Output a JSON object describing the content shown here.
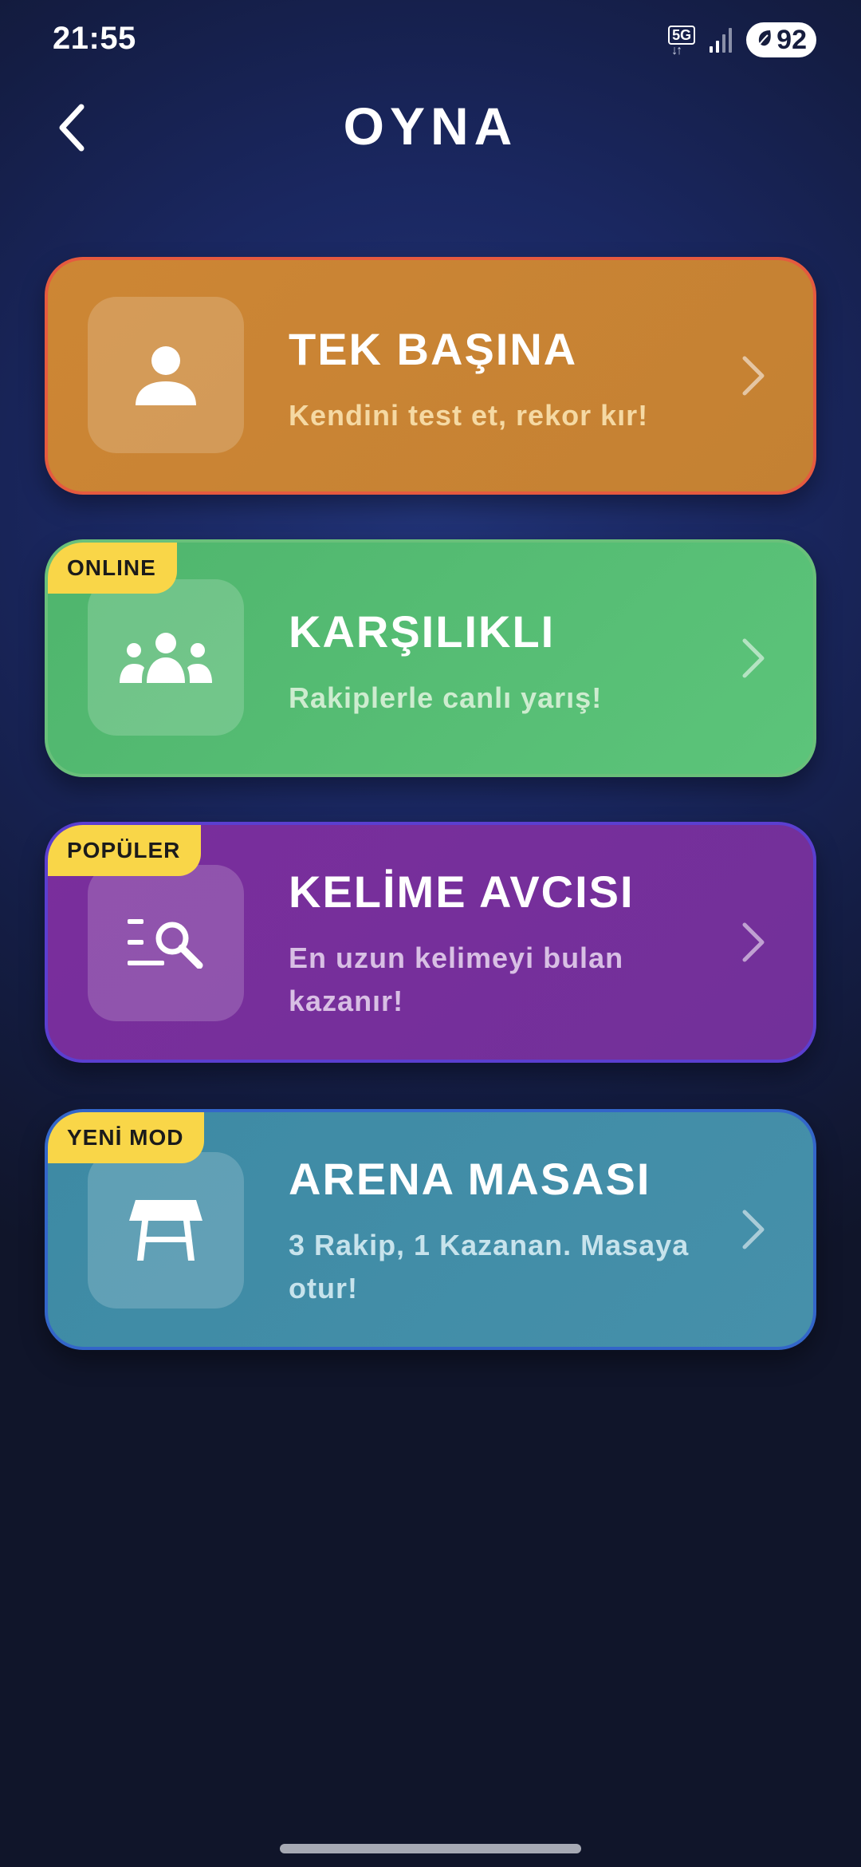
{
  "status_bar": {
    "time": "21:55",
    "network": "5G",
    "battery": "92"
  },
  "header": {
    "title": "OYNA",
    "back_icon": "chevron-left-icon"
  },
  "modes": [
    {
      "title": "TEK BAŞINA",
      "subtitle": "Kendini test et, rekor kır!",
      "badge": "",
      "icon": "person-icon",
      "color": "#c8842f"
    },
    {
      "title": "KARŞILIKLI",
      "subtitle": "Rakiplerle canlı yarış!",
      "badge": "ONLINE",
      "icon": "group-icon",
      "color": "#55bb72"
    },
    {
      "title": "KELİME AVCISI",
      "subtitle": "En uzun kelimeyi bulan kazanır!",
      "badge": "POPÜLER",
      "icon": "list-search-icon",
      "color": "#762f9b"
    },
    {
      "title": "ARENA MASASI",
      "subtitle": "3 Rakip, 1 Kazanan. Masaya otur!",
      "badge": "YENİ MOD",
      "icon": "table-icon",
      "color": "#418ea8"
    }
  ],
  "colors": {
    "background": "#1a2760",
    "badge": "#f9d648",
    "solo_border": "#e55a3f",
    "hunt_border": "#5b3fd0",
    "arena_border": "#3366c9"
  }
}
